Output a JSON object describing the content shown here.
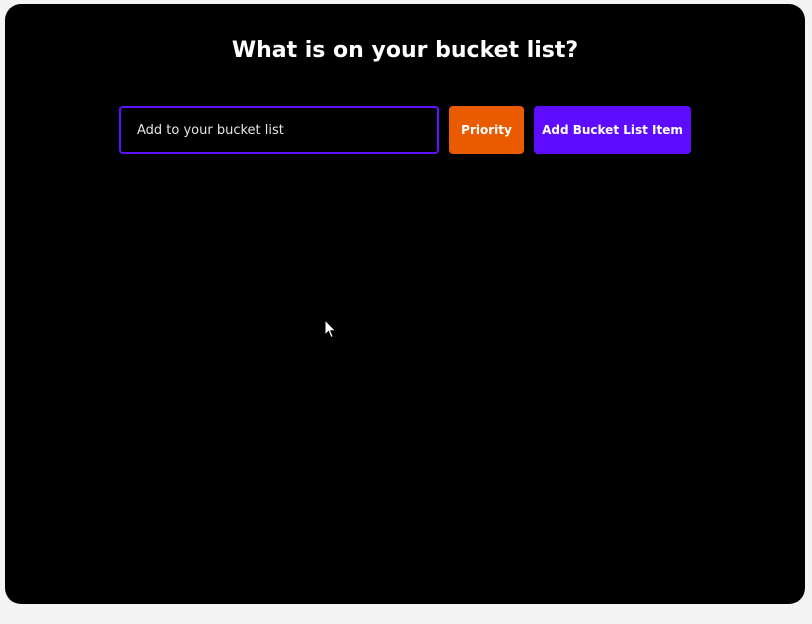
{
  "app": {
    "title": "What is on your bucket list?"
  },
  "form": {
    "input_placeholder": "Add to your bucket list",
    "input_value": "",
    "priority_label": "Priority",
    "add_button_label": "Add Bucket List Item"
  },
  "colors": {
    "background": "#000000",
    "accent_purple": "#5d0cff",
    "accent_orange": "#ea5b00",
    "text": "#ffffff"
  },
  "icons": {
    "cursor": "mouse-pointer-icon"
  }
}
